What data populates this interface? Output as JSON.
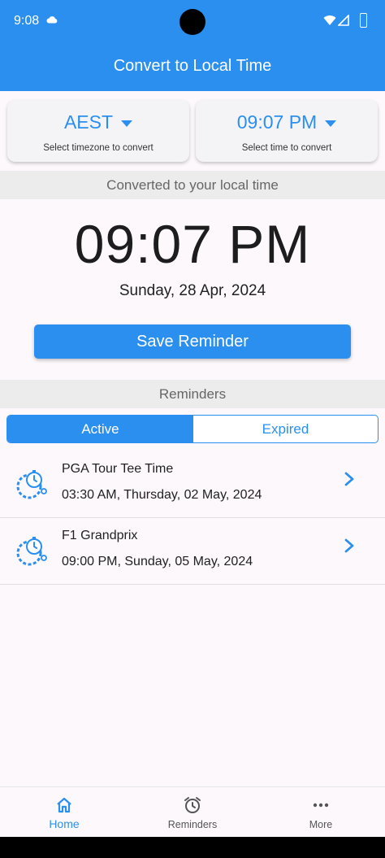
{
  "status_bar": {
    "time": "9:08"
  },
  "header": {
    "title": "Convert to Local Time"
  },
  "pickers": {
    "timezone": {
      "value": "AEST",
      "hint": "Select timezone to convert"
    },
    "time": {
      "value": "09:07 PM",
      "hint": "Select time to convert"
    }
  },
  "converted": {
    "section_label": "Converted to your local time",
    "time": "09:07 PM",
    "date": "Sunday, 28 Apr, 2024"
  },
  "save_button": "Save Reminder",
  "reminders": {
    "section_label": "Reminders",
    "tabs": {
      "active": "Active",
      "expired": "Expired",
      "selected": "Active"
    },
    "items": [
      {
        "title": "PGA Tour Tee Time",
        "datetime": "03:30 AM, Thursday, 02 May, 2024",
        "icon": "timer-gear-icon"
      },
      {
        "title": "F1 Grandprix",
        "datetime": "09:00 PM, Sunday, 05 May, 2024",
        "icon": "timer-gear-icon"
      }
    ]
  },
  "bottom_nav": {
    "items": [
      {
        "label": "Home",
        "icon": "home-icon",
        "selected": true
      },
      {
        "label": "Reminders",
        "icon": "alarm-clock-icon",
        "selected": false
      },
      {
        "label": "More",
        "icon": "more-dots-icon",
        "selected": false
      }
    ]
  },
  "colors": {
    "primary": "#2b8ff0",
    "band": "#ececec",
    "background": "#fcf8fc"
  }
}
